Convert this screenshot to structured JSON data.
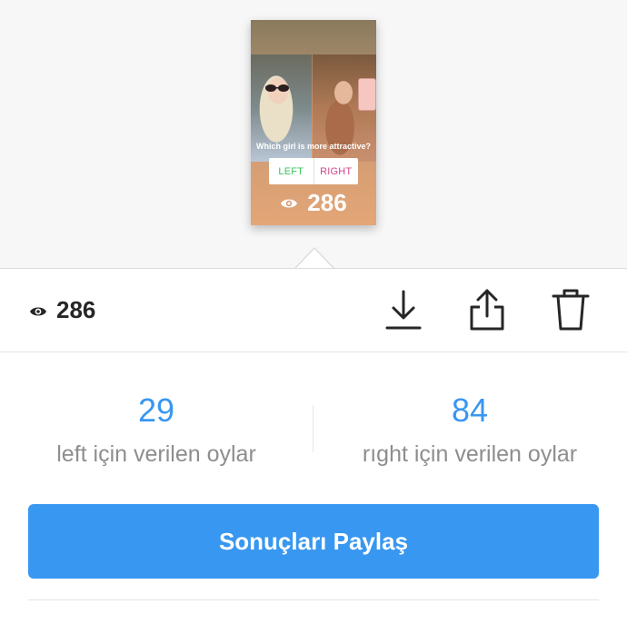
{
  "story": {
    "question": "Which girl is more attractive?",
    "poll_left": "LEFT",
    "poll_right": "RIGHT",
    "views": "286"
  },
  "toolbar": {
    "views": "286",
    "icons": [
      "eye-icon",
      "download-icon",
      "share-icon",
      "trash-icon"
    ]
  },
  "results": {
    "left": {
      "count": "29",
      "label": "left için verilen oylar"
    },
    "right": {
      "count": "84",
      "label": "rıght için verilen oylar"
    }
  },
  "share_button": "Sonuçları Paylaş",
  "colors": {
    "accent": "#3897f0",
    "poll_left": "#3cc35a",
    "poll_right": "#d0468e",
    "text_muted": "#8e8e8e"
  }
}
